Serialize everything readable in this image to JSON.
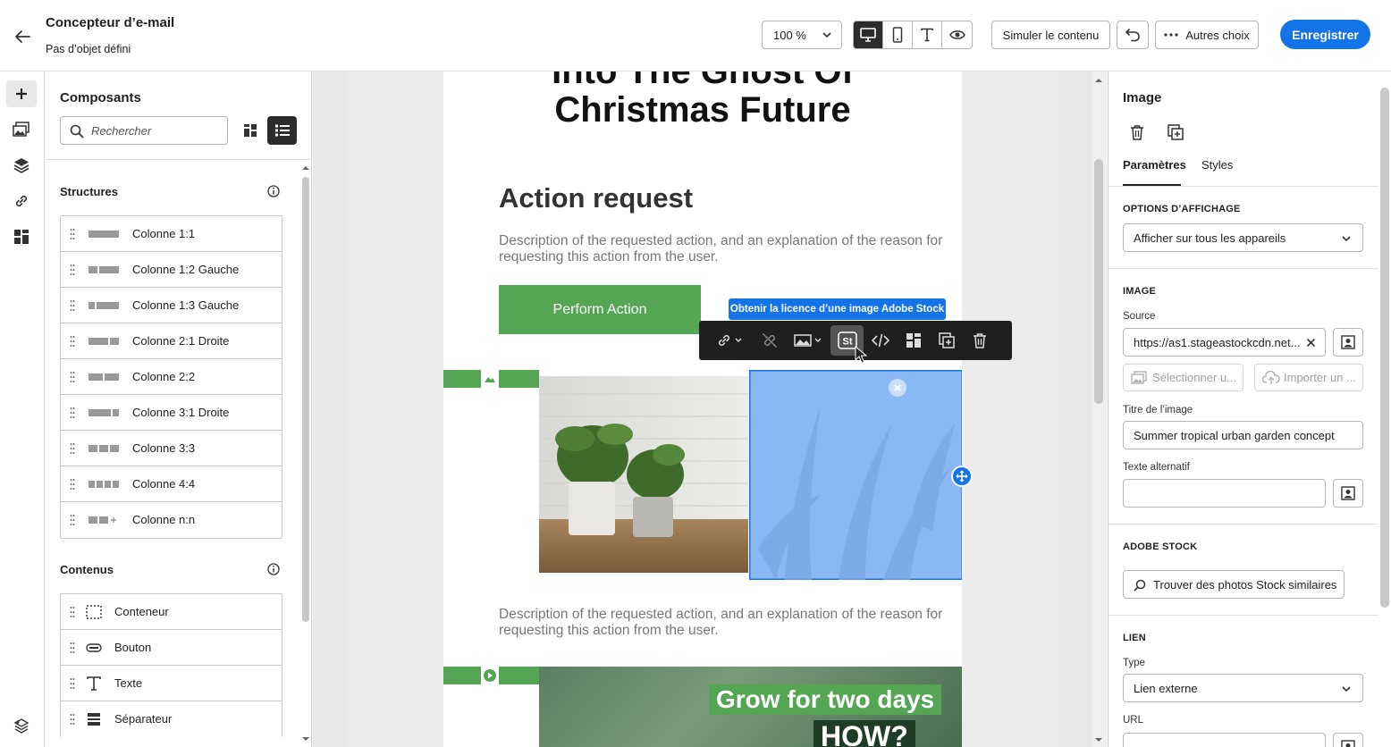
{
  "header": {
    "title": "Concepteur d’e-mail",
    "subtitle": "Pas d’objet défini",
    "zoom": "100 %",
    "simulate_label": "Simuler le contenu",
    "more_label": "Autres choix",
    "save_label": "Enregistrer"
  },
  "components": {
    "title": "Composants",
    "search_placeholder": "Rechercher",
    "structures_title": "Structures",
    "structures": [
      {
        "label": "Colonne 1:1"
      },
      {
        "label": "Colonne 1:2 Gauche"
      },
      {
        "label": "Colonne 1:3 Gauche"
      },
      {
        "label": "Colonne 2:1 Droite"
      },
      {
        "label": "Colonne 2:2"
      },
      {
        "label": "Colonne 3:1 Droite"
      },
      {
        "label": "Colonne 3:3"
      },
      {
        "label": "Colonne 4:4"
      },
      {
        "label": "Colonne n:n"
      }
    ],
    "contents_title": "Contenus",
    "contents": [
      {
        "label": "Conteneur"
      },
      {
        "label": "Bouton"
      },
      {
        "label": "Texte"
      },
      {
        "label": "Séparateur"
      }
    ]
  },
  "email": {
    "headline_1": "Into The Ghost Of",
    "headline_2": "Christmas Future",
    "section_title": "Action request",
    "description_1": "Description of the requested action, and an explanation of the reason for requesting this action from the user.",
    "action_button": "Perform Action",
    "description_2": "Description of the requested action, and an explanation of the reason for requesting this action from the user.",
    "banner_line_1": "Grow for two days",
    "banner_line_2": "HOW?"
  },
  "toolbar": {
    "tooltip": "Obtenir la licence d’une image  Adobe Stock",
    "stock_glyph": "St"
  },
  "properties": {
    "title": "Image",
    "tab_params": "Paramètres",
    "tab_styles": "Styles",
    "display_section": "OPTIONS D’AFFICHAGE",
    "display_value": "Afficher sur tous les appareils",
    "image_section": "IMAGE",
    "source_label": "Source",
    "source_value": "https://as1.stageastockcdn.net...",
    "select_label": "Sélectionner u...",
    "import_label": "Importer un ...",
    "image_title_label": "Titre de l’image",
    "image_title_value": "Summer tropical urban garden concept",
    "alt_label": "Texte alternatif",
    "alt_value": "",
    "stock_section": "ADOBE STOCK",
    "stock_button": "Trouver des photos Stock similaires",
    "link_section": "LIEN",
    "type_label": "Type",
    "type_value": "Lien externe",
    "url_label": "URL"
  },
  "colors": {
    "accent": "#1473e6",
    "green": "#54a654",
    "selection": "#8ab8f5"
  }
}
